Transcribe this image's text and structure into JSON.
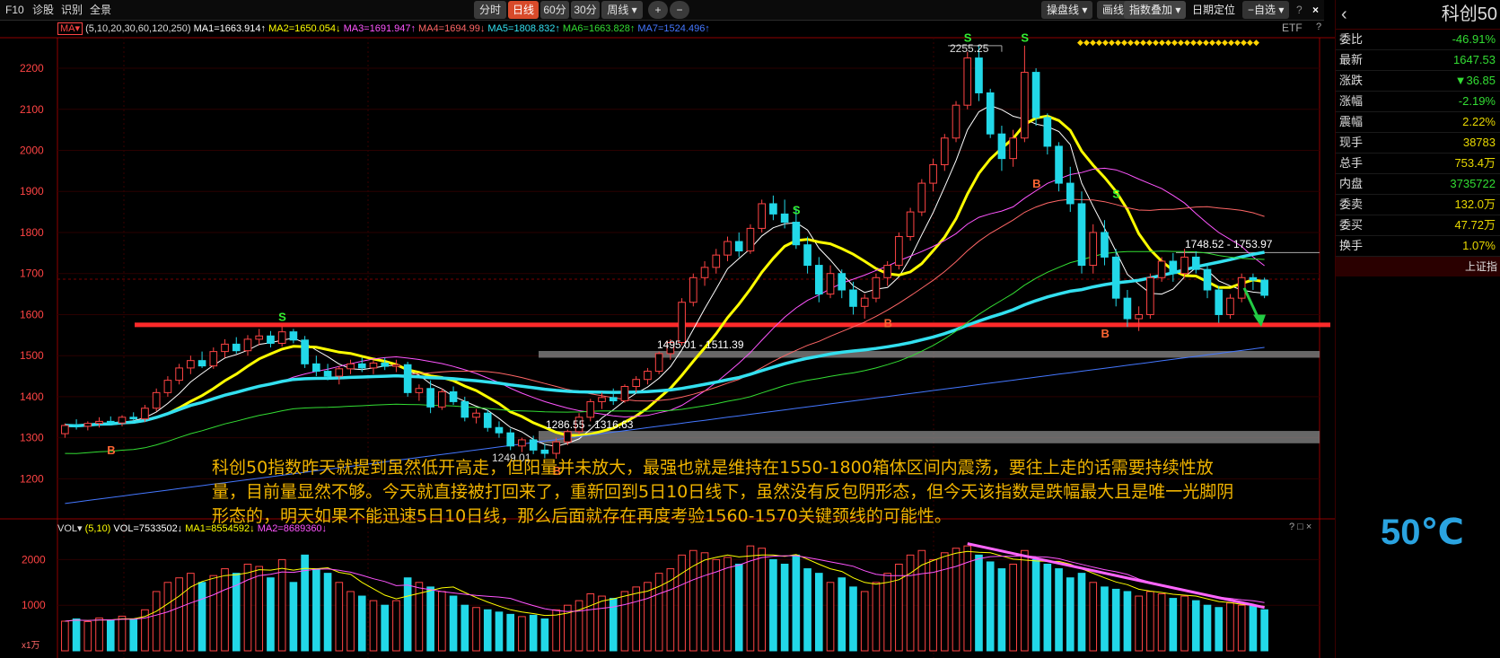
{
  "toolbar": {
    "left_items": [
      "F10",
      "诊股",
      "识别",
      "全景"
    ],
    "periods": [
      "分时",
      "日线",
      "60分",
      "30分",
      "周线 ▾"
    ],
    "active_period": "日线",
    "zoom": [
      "+",
      "−"
    ],
    "right_items": [
      "操盘线 ▾",
      "画线",
      "指数叠加 ▾",
      "日期定位",
      "−自选 ▾"
    ],
    "help": "?",
    "close": "×"
  },
  "ma_legend": {
    "prefix": "MA▾",
    "params": "(5,10,20,30,60,120,250)",
    "items": [
      {
        "label": "MA1=1663.914↑",
        "color": "#ffffff"
      },
      {
        "label": "MA2=1650.054↓",
        "color": "#ffff00"
      },
      {
        "label": "MA3=1691.947↑",
        "color": "#ff55ff"
      },
      {
        "label": "MA4=1694.99↓",
        "color": "#ff6666"
      },
      {
        "label": "MA5=1808.832↑",
        "color": "#33e0f0"
      },
      {
        "label": "MA6=1663.828↑",
        "color": "#33dd33"
      },
      {
        "label": "MA7=1524.496↑",
        "color": "#4477ff"
      }
    ],
    "etf": "ETF",
    "q": "?"
  },
  "vol_legend": {
    "prefix": "VOL▾",
    "params": "(5,10)",
    "items": [
      {
        "label": "VOL=7533502↓",
        "color": "#ffffff"
      },
      {
        "label": "MA1=8554592↓",
        "color": "#ffff00"
      },
      {
        "label": "MA2=8689360↓",
        "color": "#ff55ff"
      }
    ],
    "corner": "? □ ×"
  },
  "annotations": {
    "high": "2255.25",
    "low": "1249.01",
    "zone1": "1495.01 - 1511.39",
    "zone2": "1286.55 - 1316.63",
    "zone3": "1748.52 - 1753.97",
    "scale": "x1万"
  },
  "note_lines": [
    "科创50指数昨天就提到虽然低开高走，但阳量并未放大，最强也就是维持在1550-1800箱体区间内震荡，要往上走的话需要持续性放",
    "量，目前量显然不够。今天就直接被打回来了，重新回到5日10日线下，虽然没有反包阴形态，但今天该指数是跌幅最大且是唯一光脚阴",
    "形态的，明天如果不能迅速5日10日线，那么后面就存在再度考验1560-1570关键颈线的可能性。"
  ],
  "right_panel": {
    "title": "科创50",
    "arrow": "‹",
    "rows": [
      {
        "label": "委比",
        "value": "-46.91%",
        "tone": "dn"
      },
      {
        "label": "最新",
        "value": "1647.53",
        "tone": "dn"
      },
      {
        "label": "涨跌",
        "value": "▼36.85",
        "tone": "dn"
      },
      {
        "label": "涨幅",
        "value": "-2.19%",
        "tone": "dn"
      },
      {
        "label": "震幅",
        "value": "2.22%",
        "tone": "yl"
      },
      {
        "label": "现手",
        "value": "38783",
        "tone": "yl"
      },
      {
        "label": "总手",
        "value": "753.4万",
        "tone": "yl"
      },
      {
        "label": "内盘",
        "value": "3735722",
        "tone": "dn"
      },
      {
        "label": "委卖",
        "value": "132.0万",
        "tone": "yl"
      },
      {
        "label": "委买",
        "value": "47.72万",
        "tone": "yl"
      },
      {
        "label": "换手",
        "value": "1.07%",
        "tone": "yl"
      }
    ],
    "footer": "上证指"
  },
  "temperature": "50℃",
  "colors": {
    "up": "#ff4444",
    "down": "#22d8e8",
    "grid": "#3a0000",
    "support": "#ff2a2a"
  },
  "chart_data": {
    "type": "candlestick",
    "y_ticks": [
      1200,
      1300,
      1400,
      1500,
      1600,
      1700,
      1800,
      1900,
      2000,
      2100,
      2200
    ],
    "ylim": [
      1120,
      2270
    ],
    "vol_ticks": [
      1000,
      2000
    ],
    "vol_ylim": [
      0,
      2500
    ],
    "support_level": 1575,
    "zones": [
      [
        1495.01,
        1511.39
      ],
      [
        1286.55,
        1316.63
      ]
    ],
    "ohlc": [
      [
        1310,
        1335,
        1300,
        1330
      ],
      [
        1330,
        1345,
        1320,
        1328
      ],
      [
        1328,
        1340,
        1318,
        1335
      ],
      [
        1335,
        1350,
        1325,
        1340
      ],
      [
        1340,
        1352,
        1330,
        1336
      ],
      [
        1336,
        1355,
        1328,
        1350
      ],
      [
        1350,
        1362,
        1340,
        1346
      ],
      [
        1346,
        1380,
        1338,
        1372
      ],
      [
        1372,
        1420,
        1365,
        1410
      ],
      [
        1410,
        1450,
        1400,
        1440
      ],
      [
        1440,
        1480,
        1430,
        1470
      ],
      [
        1470,
        1500,
        1455,
        1488
      ],
      [
        1488,
        1510,
        1470,
        1475
      ],
      [
        1475,
        1520,
        1468,
        1510
      ],
      [
        1510,
        1540,
        1495,
        1528
      ],
      [
        1528,
        1545,
        1505,
        1512
      ],
      [
        1512,
        1550,
        1500,
        1540
      ],
      [
        1540,
        1565,
        1525,
        1548
      ],
      [
        1548,
        1560,
        1520,
        1530
      ],
      [
        1530,
        1570,
        1522,
        1558
      ],
      [
        1558,
        1565,
        1530,
        1538
      ],
      [
        1538,
        1548,
        1470,
        1480
      ],
      [
        1480,
        1500,
        1450,
        1462
      ],
      [
        1462,
        1480,
        1440,
        1450
      ],
      [
        1450,
        1475,
        1430,
        1468
      ],
      [
        1468,
        1490,
        1455,
        1480
      ],
      [
        1480,
        1495,
        1460,
        1470
      ],
      [
        1470,
        1488,
        1455,
        1482
      ],
      [
        1482,
        1495,
        1465,
        1474
      ],
      [
        1474,
        1490,
        1460,
        1478
      ],
      [
        1478,
        1485,
        1400,
        1410
      ],
      [
        1410,
        1430,
        1390,
        1420
      ],
      [
        1420,
        1440,
        1360,
        1375
      ],
      [
        1375,
        1420,
        1368,
        1412
      ],
      [
        1412,
        1425,
        1380,
        1388
      ],
      [
        1388,
        1400,
        1340,
        1350
      ],
      [
        1350,
        1370,
        1335,
        1360
      ],
      [
        1360,
        1368,
        1315,
        1325
      ],
      [
        1325,
        1340,
        1300,
        1312
      ],
      [
        1312,
        1322,
        1270,
        1280
      ],
      [
        1280,
        1300,
        1265,
        1295
      ],
      [
        1295,
        1305,
        1260,
        1270
      ],
      [
        1270,
        1285,
        1250,
        1262
      ],
      [
        1262,
        1300,
        1249,
        1290
      ],
      [
        1290,
        1320,
        1282,
        1315
      ],
      [
        1315,
        1360,
        1308,
        1350
      ],
      [
        1350,
        1395,
        1340,
        1388
      ],
      [
        1388,
        1410,
        1370,
        1398
      ],
      [
        1398,
        1420,
        1380,
        1390
      ],
      [
        1390,
        1430,
        1385,
        1425
      ],
      [
        1425,
        1450,
        1410,
        1442
      ],
      [
        1442,
        1470,
        1430,
        1462
      ],
      [
        1462,
        1510,
        1455,
        1505
      ],
      [
        1505,
        1540,
        1490,
        1532
      ],
      [
        1532,
        1640,
        1525,
        1630
      ],
      [
        1630,
        1700,
        1620,
        1690
      ],
      [
        1690,
        1730,
        1670,
        1715
      ],
      [
        1715,
        1760,
        1700,
        1745
      ],
      [
        1745,
        1790,
        1730,
        1778
      ],
      [
        1778,
        1800,
        1740,
        1755
      ],
      [
        1755,
        1820,
        1748,
        1810
      ],
      [
        1810,
        1880,
        1800,
        1870
      ],
      [
        1870,
        1890,
        1830,
        1845
      ],
      [
        1845,
        1880,
        1810,
        1825
      ],
      [
        1825,
        1860,
        1760,
        1770
      ],
      [
        1770,
        1790,
        1700,
        1720
      ],
      [
        1720,
        1740,
        1630,
        1650
      ],
      [
        1650,
        1720,
        1640,
        1700
      ],
      [
        1700,
        1710,
        1640,
        1660
      ],
      [
        1660,
        1680,
        1600,
        1620
      ],
      [
        1620,
        1650,
        1590,
        1640
      ],
      [
        1640,
        1700,
        1630,
        1690
      ],
      [
        1690,
        1730,
        1670,
        1720
      ],
      [
        1720,
        1800,
        1710,
        1790
      ],
      [
        1790,
        1860,
        1780,
        1850
      ],
      [
        1850,
        1930,
        1840,
        1920
      ],
      [
        1920,
        1980,
        1900,
        1965
      ],
      [
        1965,
        2040,
        1950,
        2030
      ],
      [
        2030,
        2120,
        2020,
        2110
      ],
      [
        2110,
        2240,
        2100,
        2225
      ],
      [
        2225,
        2255,
        2120,
        2140
      ],
      [
        2140,
        2150,
        2030,
        2040
      ],
      [
        2040,
        2060,
        1950,
        1980
      ],
      [
        1980,
        2050,
        1960,
        2030
      ],
      [
        2030,
        2255,
        2020,
        2190
      ],
      [
        2190,
        2200,
        2060,
        2080
      ],
      [
        2080,
        2090,
        1990,
        2010
      ],
      [
        2010,
        2020,
        1900,
        1920
      ],
      [
        1920,
        1960,
        1850,
        1870
      ],
      [
        1870,
        1900,
        1700,
        1720
      ],
      [
        1720,
        1820,
        1700,
        1800
      ],
      [
        1800,
        1830,
        1720,
        1740
      ],
      [
        1740,
        1760,
        1620,
        1640
      ],
      [
        1640,
        1660,
        1570,
        1590
      ],
      [
        1590,
        1620,
        1560,
        1600
      ],
      [
        1600,
        1700,
        1590,
        1690
      ],
      [
        1690,
        1740,
        1680,
        1730
      ],
      [
        1730,
        1750,
        1680,
        1700
      ],
      [
        1700,
        1760,
        1690,
        1740
      ],
      [
        1740,
        1754,
        1700,
        1710
      ],
      [
        1710,
        1720,
        1640,
        1660
      ],
      [
        1660,
        1670,
        1580,
        1600
      ],
      [
        1600,
        1650,
        1590,
        1640
      ],
      [
        1640,
        1700,
        1630,
        1690
      ],
      [
        1690,
        1700,
        1660,
        1684
      ],
      [
        1684,
        1690,
        1640,
        1647
      ]
    ],
    "volume": [
      650,
      700,
      640,
      720,
      680,
      760,
      700,
      900,
      1300,
      1500,
      1600,
      1700,
      1500,
      1650,
      1800,
      1700,
      1900,
      1850,
      1600,
      2000,
      1500,
      2100,
      1800,
      1700,
      1500,
      1300,
      1200,
      1100,
      1000,
      1100,
      1600,
      1500,
      1400,
      1300,
      1200,
      1000,
      950,
      900,
      850,
      800,
      750,
      780,
      700,
      900,
      1000,
      1100,
      1250,
      1200,
      1150,
      1300,
      1400,
      1500,
      1700,
      1800,
      2100,
      2200,
      2150,
      2000,
      2050,
      1900,
      2300,
      2250,
      2000,
      1900,
      2100,
      1800,
      1700,
      1500,
      1600,
      1400,
      1300,
      1500,
      1700,
      1900,
      2100,
      2200,
      2000,
      2150,
      2250,
      2300,
      2100,
      1950,
      1800,
      1900,
      2200,
      2000,
      1900,
      1800,
      1600,
      1700,
      1500,
      1400,
      1350,
      1300,
      1200,
      1300,
      1250,
      1150,
      1200,
      1100,
      1000,
      950,
      1050,
      1000,
      980,
      900
    ],
    "series": [
      {
        "name": "MA1",
        "color": "#ffffff"
      },
      {
        "name": "MA2",
        "color": "#ffff00"
      },
      {
        "name": "MA3",
        "color": "#ff55ff"
      },
      {
        "name": "MA4",
        "color": "#ff6666"
      },
      {
        "name": "MA5",
        "color": "#33e0f0"
      },
      {
        "name": "MA6",
        "color": "#33dd33"
      },
      {
        "name": "MA7",
        "color": "#4477ff"
      }
    ]
  }
}
